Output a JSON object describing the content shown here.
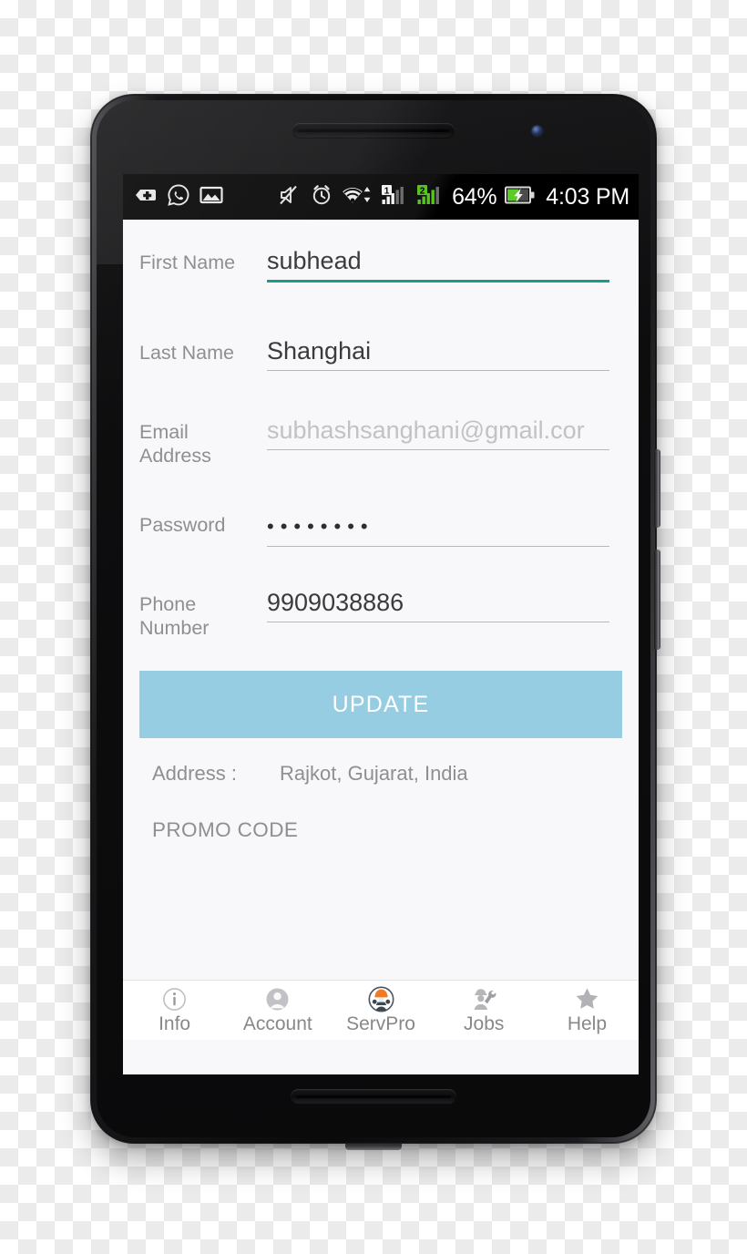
{
  "status_bar": {
    "left_icons": [
      "add-tag-icon",
      "whatsapp-icon",
      "gallery-image-icon"
    ],
    "right_icons": [
      "mute-icon",
      "alarm-clock-icon",
      "wifi-icon",
      "sim1-signal-icon",
      "sim2-signal-icon",
      "battery-charging-icon"
    ],
    "battery_percent": "64%",
    "clock": "4:03 PM",
    "sim1_label": "1",
    "sim2_label": "2"
  },
  "form": {
    "fields": [
      {
        "label": "First Name",
        "value": "subhead",
        "state": "focused",
        "is_placeholder": false,
        "type": "text"
      },
      {
        "label": "Last Name",
        "value": "Shanghai",
        "state": "normal",
        "is_placeholder": false,
        "type": "text"
      },
      {
        "label": "Email Address",
        "label_line1": "Email",
        "label_line2": "Address",
        "value": "subhashsanghani@gmail.cor",
        "state": "normal",
        "is_placeholder": true,
        "type": "email"
      },
      {
        "label": "Password",
        "value": "••••••••",
        "state": "normal",
        "is_placeholder": false,
        "type": "password"
      },
      {
        "label": "Phone Number",
        "label_line1": "Phone",
        "label_line2": "Number",
        "value": "9909038886",
        "state": "normal",
        "is_placeholder": false,
        "type": "tel"
      }
    ],
    "update_button_label": "UPDATE",
    "address_label": "Address :",
    "address_value": "Rajkot, Gujarat, India",
    "promo_code_label": "PROMO CODE"
  },
  "bottom_nav": {
    "items": [
      {
        "label": "Info",
        "icon": "info-circle-icon"
      },
      {
        "label": "Account",
        "icon": "person-icon"
      },
      {
        "label": "ServPro",
        "icon": "servpro-worker-icon"
      },
      {
        "label": "Jobs",
        "icon": "worker-wrench-icon"
      },
      {
        "label": "Help",
        "icon": "star-icon"
      }
    ]
  },
  "colors": {
    "accent_focus_underline": "#179c8e",
    "update_button_bg": "#96cde3",
    "screen_bg": "#f8f8fa",
    "status_bar_bg": "#000000",
    "label_gray": "#8e8e93",
    "servpro_orange": "#f07b22",
    "sim2_green": "#58c422",
    "battery_green": "#5bcb2a"
  }
}
